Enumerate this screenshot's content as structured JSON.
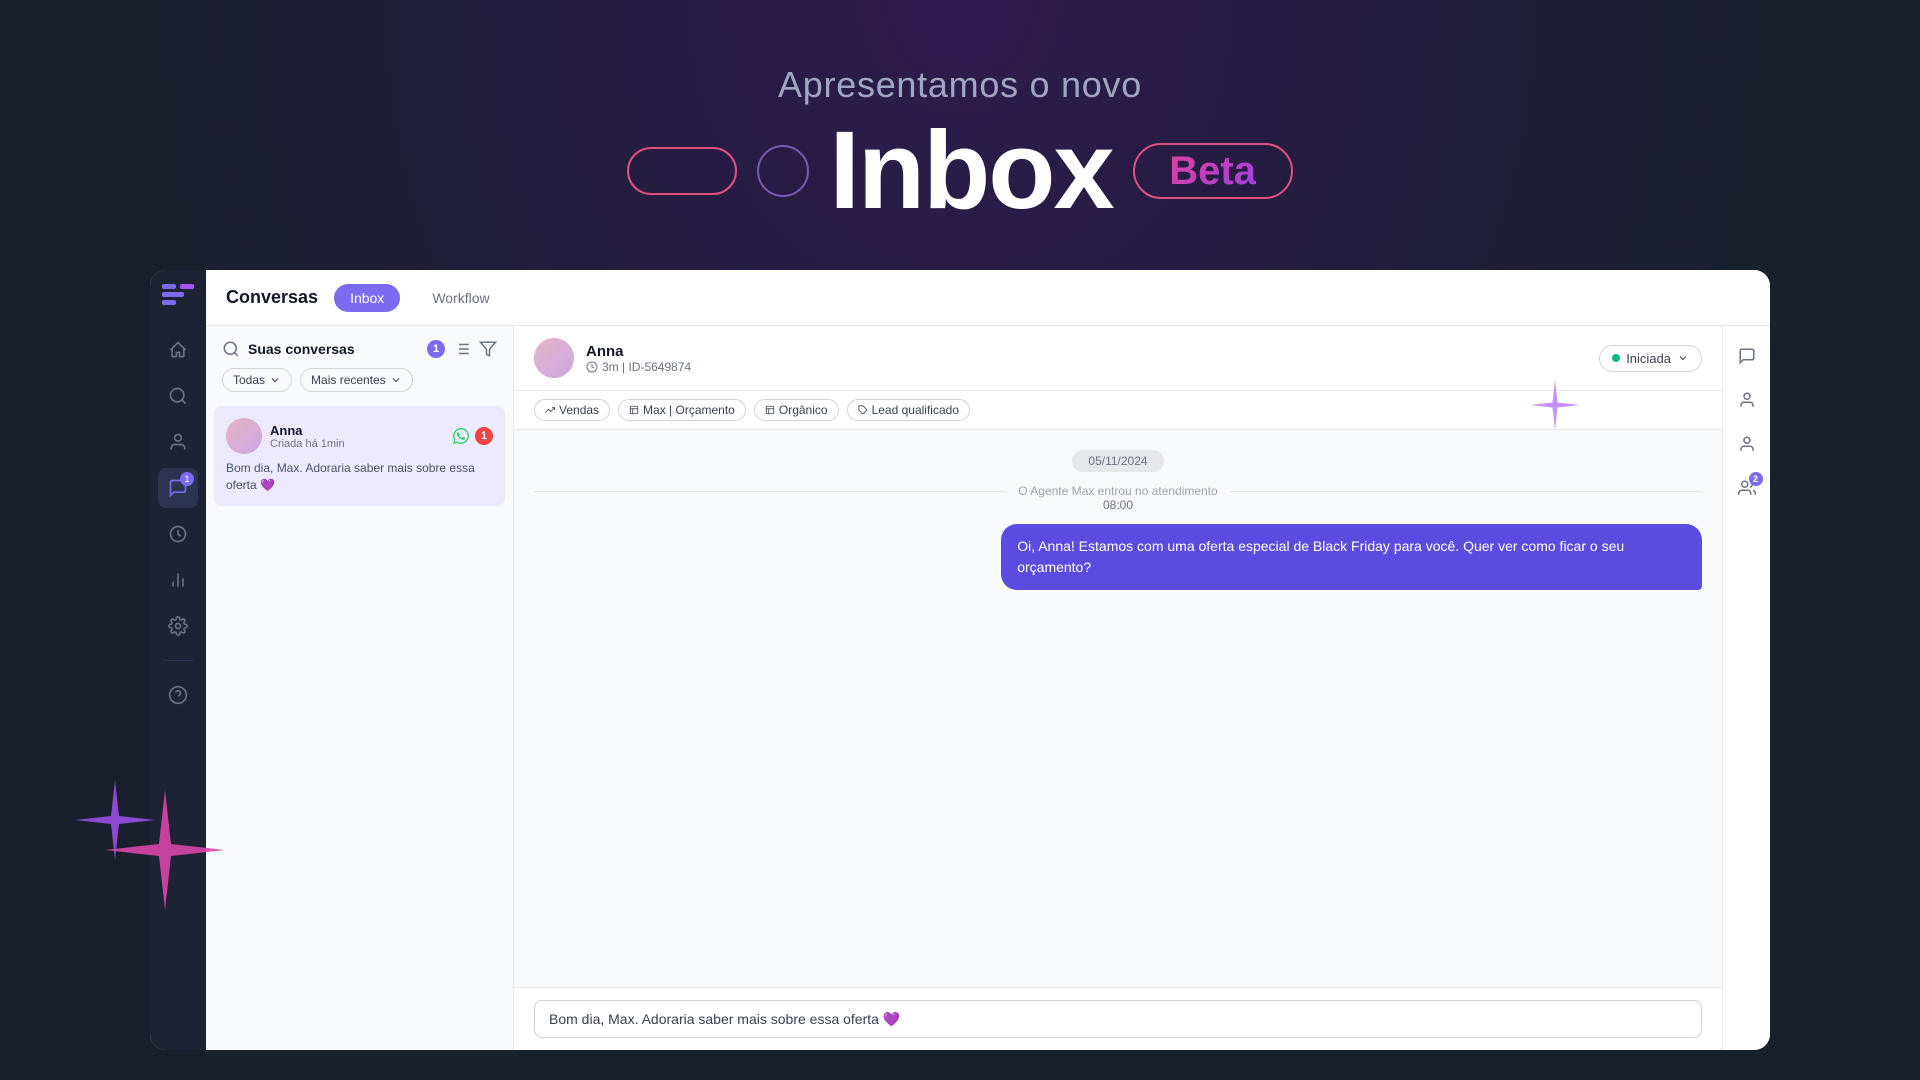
{
  "hero": {
    "subtitle": "Apresentamos o novo",
    "title": "Inbox",
    "beta_label": "Beta"
  },
  "tabs": {
    "conversas_label": "Conversas",
    "inbox_label": "Inbox",
    "workflow_label": "Workflow"
  },
  "conv_panel": {
    "title": "Suas conversas",
    "count": "1",
    "filter_all": "Todas",
    "filter_recent": "Mais recentes"
  },
  "conversation": {
    "name": "Anna",
    "created": "Criada há 1min",
    "message": "Bom dia, Max. Adoraria saber mais sobre essa oferta 💜"
  },
  "chat": {
    "contact_name": "Anna",
    "meta": "3m | ID-5649874",
    "status": "Iniciada",
    "tags": [
      "Vendas",
      "Max | Orçamento",
      "Orgânico",
      "Lead qualificado"
    ],
    "date_separator": "05/11/2024",
    "system_msg": "O Agente Max entrou no atendimento",
    "system_time": "08:00",
    "agent_msg": "Oi, Anna! Estamos com uma oferta especial de Black Friday para você. Quer ver como ficar o seu orçamento?",
    "user_input": "Bom dia, Max. Adoraria saber mais sobre essa oferta 💜"
  },
  "sidebar": {
    "badge_count": "1",
    "right_badge": "2"
  },
  "icons": {
    "home": "🏠",
    "search": "🔍",
    "contacts": "👤",
    "inbox": "💬",
    "clock": "🕐",
    "chart": "📊",
    "settings": "⚙️",
    "help": "❓"
  }
}
